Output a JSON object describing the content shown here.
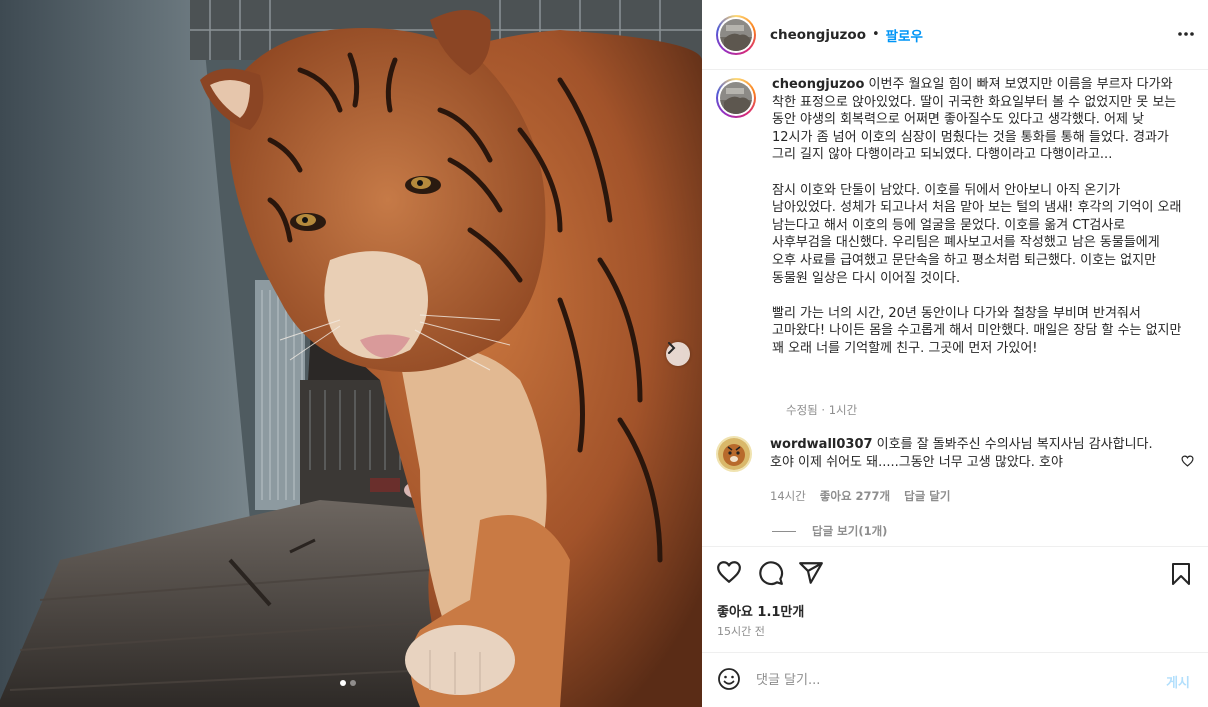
{
  "post": {
    "username": "cheongjuzoo",
    "follow_label": "팔로우",
    "separator": "•",
    "more_icon": "more-horizontal-icon"
  },
  "caption": {
    "username": "cheongjuzoo",
    "text": " 이번주 월요일 힘이 빠져 보였지만 이름을 부르자 다가와 착한 표정으로 앉아있었다. 딸이 귀국한 화요일부터 볼 수 없었지만 못 보는 동안 야생의 회복력으로 어쩌면 좋아질수도 있다고 생각했다. 어제 낮 12시가 좀 넘어 이호의 심장이 멈췄다는 것을 통화를 통해 들었다. 경과가 그리 길지 않아 다행이라고 되뇌였다. 다행이라고 다행이라고...\n\n잠시 이호와 단둘이 남았다. 이호를 뒤에서 안아보니 아직 온기가 남아있었다. 성체가 되고나서 처음 맡아 보는 털의 냄새! 후각의 기억이 오래 남는다고 해서 이호의 등에 얼굴을 묻었다. 이호를 옮겨 CT검사로 사후부검을 대신했다. 우리팀은 폐사보고서를 작성했고 남은 동물들에게 오후 사료를 급여했고 문단속을 하고 평소처럼 퇴근했다. 이호는 없지만 동물원 일상은 다시 이어질 것이다.\n\n빨리 가는 너의 시간, 20년 동안이나 다가와 철창을 부비며 반겨줘서 고마왔다! 나이든 몸을 수고롭게 해서 미안했다. 매일은 장담 할 수는 없지만 꽤 오래 너를 기억할께 친구. 그곳에 먼저 가있어!",
    "meta": "수정됨 · 1시간"
  },
  "comment": {
    "username": "wordwall0307",
    "text": " 이호를 잘 돌봐주신 수의사님 복지사님 감사합니다. 호야 이제 쉬어도 돼.....그동안 너무 고생 많았다. 호야",
    "time": "14시간",
    "likes": "좋아요 277개",
    "reply": "답글 달기",
    "view_replies": "답글 보기(1개)"
  },
  "stats": {
    "likes": "좋아요 1.1만개",
    "time": "15시간 전"
  },
  "input": {
    "placeholder": "댓글 달기...",
    "post_label": "게시"
  },
  "carousel": {
    "current": 1,
    "total": 2
  },
  "colors": {
    "accent": "#0095f6",
    "post_disabled": "#b2dffc",
    "muted": "#8e8e8e"
  }
}
